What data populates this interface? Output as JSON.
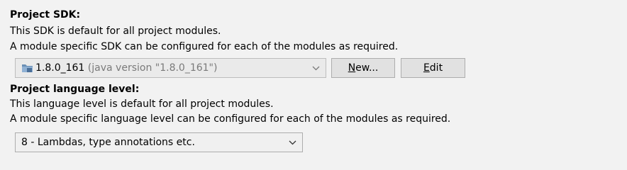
{
  "sdk": {
    "title": "Project SDK:",
    "desc1": "This SDK is default for all project modules.",
    "desc2": "A module specific SDK can be configured for each of the modules as required.",
    "selected_name": "1.8.0_161",
    "selected_detail": "(java version \"1.8.0_161\")",
    "sdk_icon": "jdk-folder-icon",
    "new_button": {
      "mnemonic": "N",
      "rest": "ew..."
    },
    "edit_button": {
      "mnemonic": "E",
      "rest": "dit"
    }
  },
  "language_level": {
    "title": "Project language level:",
    "desc1": "This language level is default for all project modules.",
    "desc2": "A module specific language level can be configured for each of the modules as required.",
    "selected": "8 - Lambdas, type annotations etc."
  },
  "colors": {
    "background": "#f2f2f2",
    "disabled_text": "#7a7a7a"
  }
}
